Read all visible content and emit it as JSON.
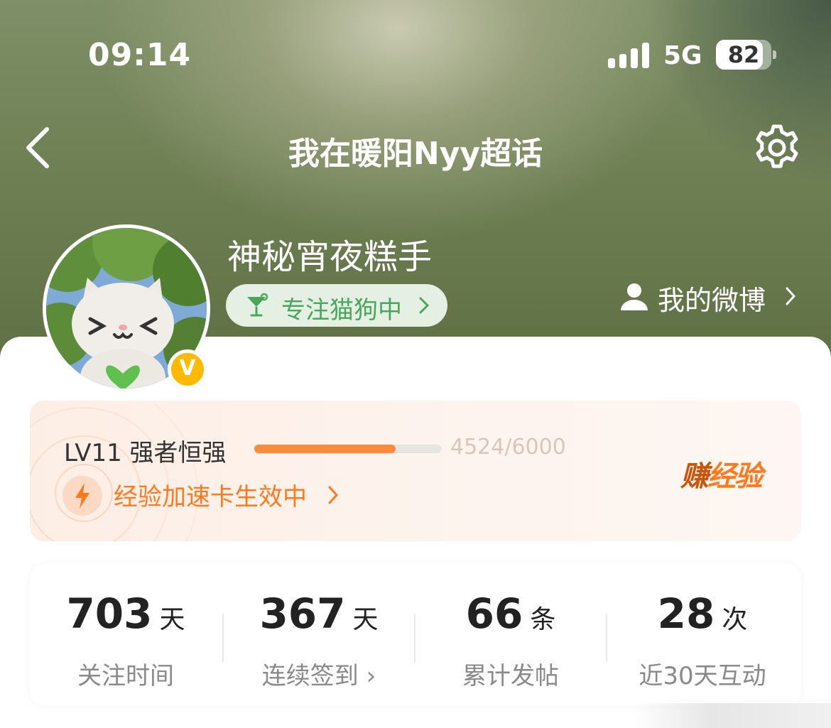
{
  "status_bar": {
    "time": "09:14",
    "network": "5G",
    "battery": "82"
  },
  "nav": {
    "title": "我在暖阳Nyy超话"
  },
  "profile": {
    "username": "神秘宵夜糕手",
    "tag_label": "专注猫狗中",
    "my_weibo_label": "我的微博",
    "verified_badge": "V"
  },
  "level": {
    "name": "LV11 强者恒强",
    "progress_text": "4524/6000",
    "progress_fraction": 0.754,
    "boost_label": "经验加速卡生效中",
    "earn_first": "赚",
    "earn_rest": "经验"
  },
  "stats": [
    {
      "value": "703",
      "unit": "天",
      "label": "关注时间"
    },
    {
      "value": "367",
      "unit": "天",
      "label": "连续签到 ›"
    },
    {
      "value": "66",
      "unit": "条",
      "label": "累计发帖"
    },
    {
      "value": "28",
      "unit": "次",
      "label": "近30天互动"
    }
  ],
  "colors": {
    "accent": "#ff7a1f",
    "progress": "#ff8a3c",
    "tag_green": "#49a75d",
    "badge_yellow": "#ffb900"
  },
  "icons": {
    "back": "chevron-left-icon",
    "settings": "gear-icon",
    "tag": "cocktail-icon",
    "person": "person-icon",
    "boost": "lightning-icon"
  }
}
